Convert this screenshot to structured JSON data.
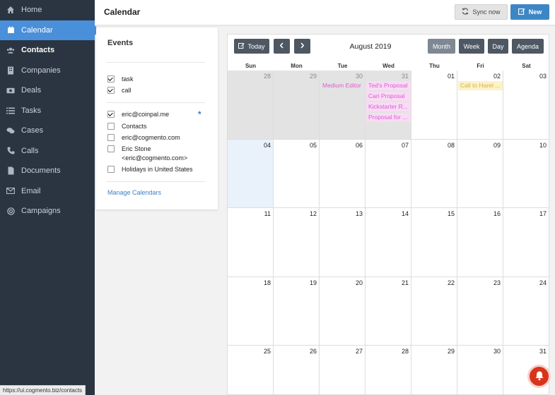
{
  "sidebar": {
    "items": [
      {
        "label": "Home",
        "icon": "home-icon"
      },
      {
        "label": "Calendar",
        "icon": "calendar-icon"
      },
      {
        "label": "Contacts",
        "icon": "users-icon"
      },
      {
        "label": "Companies",
        "icon": "building-icon"
      },
      {
        "label": "Deals",
        "icon": "money-icon"
      },
      {
        "label": "Tasks",
        "icon": "list-icon"
      },
      {
        "label": "Cases",
        "icon": "comments-icon"
      },
      {
        "label": "Calls",
        "icon": "phone-icon"
      },
      {
        "label": "Documents",
        "icon": "document-icon"
      },
      {
        "label": "Email",
        "icon": "envelope-icon"
      },
      {
        "label": "Campaigns",
        "icon": "target-icon"
      }
    ],
    "active_index": 1,
    "accent_color": "#4a8fd9",
    "background_color": "#2b3542"
  },
  "status_url": "https://ui.cogmento.biz/contacts",
  "header": {
    "title": "Calendar",
    "sync_label": "Sync now",
    "new_label": "New"
  },
  "events": {
    "title": "Events",
    "group1": [
      {
        "label": "task",
        "checked": true
      },
      {
        "label": "call",
        "checked": true
      }
    ],
    "group2": [
      {
        "label": "eric@coinpal.me",
        "checked": true
      },
      {
        "label": "Contacts",
        "checked": false
      },
      {
        "label": "eric@cogmento.com",
        "checked": false
      },
      {
        "label": "Eric Stone",
        "label2": "<eric@cogmento.com>",
        "checked": false
      },
      {
        "label": "Holidays in United States",
        "checked": false
      }
    ],
    "asterisk": "*",
    "manage_label": "Manage Calendars"
  },
  "calendar": {
    "today_label": "Today",
    "prev_icon": "chevron-left-icon",
    "next_icon": "chevron-right-icon",
    "title": "August 2019",
    "views": [
      "Month",
      "Week",
      "Day",
      "Agenda"
    ],
    "active_view": "Month",
    "day_names": [
      "Sun",
      "Mon",
      "Tue",
      "Wed",
      "Thu",
      "Fri",
      "Sat"
    ],
    "weeks": [
      [
        "28",
        "29",
        "30",
        "31",
        "01",
        "02",
        "03"
      ],
      [
        "04",
        "05",
        "06",
        "07",
        "08",
        "09",
        "10"
      ],
      [
        "11",
        "12",
        "13",
        "14",
        "15",
        "16",
        "17"
      ],
      [
        "18",
        "19",
        "20",
        "21",
        "22",
        "23",
        "24"
      ],
      [
        "25",
        "26",
        "27",
        "28",
        "29",
        "30",
        "31"
      ]
    ],
    "events": {
      "medium_editor": "Medium Editor",
      "teds_proposal": "Ted's Proposal",
      "cari_proposal": "Cari Proposal",
      "kickstarter": "Kickstarter R...",
      "proposal_for": "Proposal for ...",
      "call_harel": "Call to Harel ..."
    }
  }
}
